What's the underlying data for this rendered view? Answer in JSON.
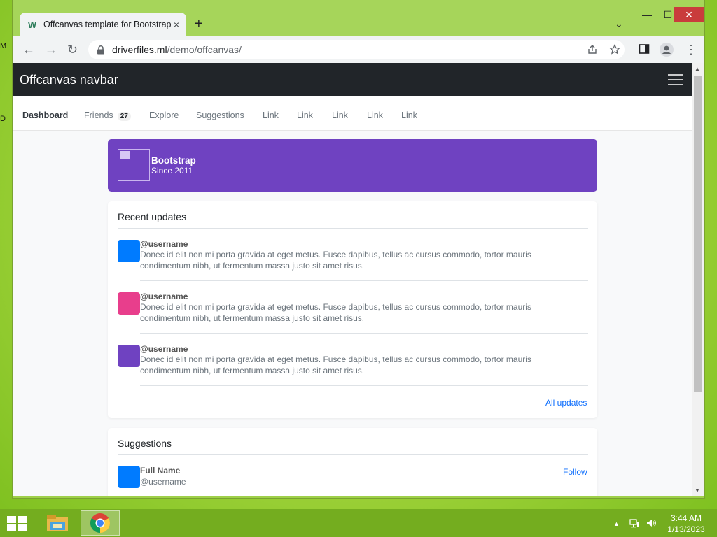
{
  "desktop": {
    "icon_fragments": [
      "M",
      "D"
    ]
  },
  "browser": {
    "tab": {
      "title": "Offcanvas template for Bootstrap",
      "favicon": "W",
      "close_icon": "×"
    },
    "new_tab_icon": "+",
    "tab_search_icon": "⌄",
    "window_controls": {
      "minimize": "—",
      "maximize": "☐",
      "close": "✕"
    },
    "nav": {
      "back": "←",
      "forward": "→",
      "reload": "↻",
      "menu": "⋮"
    },
    "address": {
      "host": "driverfiles.ml",
      "path": "/demo/offcanvas/"
    },
    "icons": [
      "lock-icon",
      "share-icon",
      "star-icon",
      "side-panel-icon",
      "profile-icon",
      "more-icon"
    ]
  },
  "page": {
    "navbar": {
      "brand": "Offcanvas navbar"
    },
    "subnav": {
      "items": [
        {
          "label": "Dashboard",
          "active": true
        },
        {
          "label": "Friends",
          "badge": "27"
        },
        {
          "label": "Explore"
        },
        {
          "label": "Suggestions"
        },
        {
          "label": "Link"
        },
        {
          "label": "Link"
        },
        {
          "label": "Link"
        },
        {
          "label": "Link"
        },
        {
          "label": "Link"
        }
      ]
    },
    "hero": {
      "title": "Bootstrap",
      "subtitle": "Since 2011"
    },
    "updates": {
      "heading": "Recent updates",
      "items": [
        {
          "user": "@username",
          "color": "#007bff",
          "text": "Donec id elit non mi porta gravida at eget metus. Fusce dapibus, tellus ac cursus commodo, tortor mauris condimentum nibh, ut fermentum massa justo sit amet risus."
        },
        {
          "user": "@username",
          "color": "#e83e8c",
          "text": "Donec id elit non mi porta gravida at eget metus. Fusce dapibus, tellus ac cursus commodo, tortor mauris condimentum nibh, ut fermentum massa justo sit amet risus."
        },
        {
          "user": "@username",
          "color": "#6f42c1",
          "text": "Donec id elit non mi porta gravida at eget metus. Fusce dapibus, tellus ac cursus commodo, tortor mauris condimentum nibh, ut fermentum massa justo sit amet risus."
        }
      ],
      "all_link": "All updates"
    },
    "suggestions": {
      "heading": "Suggestions",
      "items": [
        {
          "name": "Full Name",
          "user": "@username",
          "action": "Follow",
          "color": "#007bff"
        }
      ]
    }
  },
  "taskbar": {
    "apps": [
      "file-explorer-icon",
      "chrome-icon"
    ],
    "tray": {
      "chevron": "▲",
      "network": "network-icon",
      "volume": "volume-icon"
    },
    "clock": {
      "time": "3:44 AM",
      "date": "1/13/2023"
    }
  },
  "colors": {
    "accent": "#6f42c1",
    "navbar": "#212529",
    "link": "#0d6efd",
    "taskbar": "#74ad1f"
  }
}
